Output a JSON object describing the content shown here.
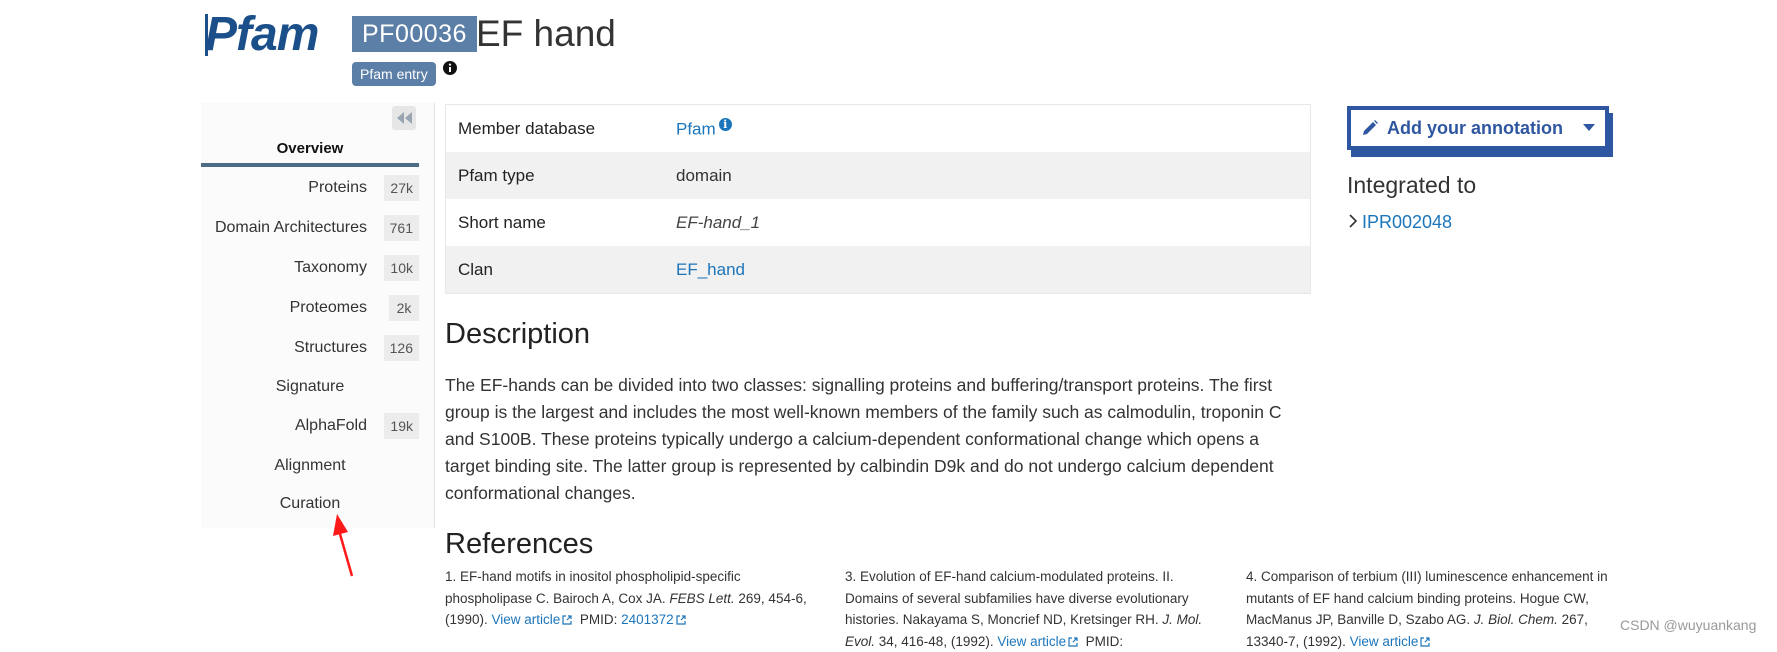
{
  "header": {
    "logo_text": "Pfam",
    "accession": "PF00036",
    "title": "EF hand",
    "entry_tag": "Pfam entry"
  },
  "sidebar": {
    "overview": "Overview",
    "items": [
      {
        "label": "Proteins",
        "count": "27k"
      },
      {
        "label": "Domain Architectures",
        "count": "761"
      },
      {
        "label": "Taxonomy",
        "count": "10k"
      },
      {
        "label": "Proteomes",
        "count": "2k"
      },
      {
        "label": "Structures",
        "count": "126"
      },
      {
        "label": "Signature",
        "count": ""
      },
      {
        "label": "AlphaFold",
        "count": "19k"
      },
      {
        "label": "Alignment",
        "count": ""
      },
      {
        "label": "Curation",
        "count": ""
      }
    ]
  },
  "info_table": {
    "rows": [
      {
        "key": "Member database",
        "value": "Pfam"
      },
      {
        "key": "Pfam type",
        "value": "domain"
      },
      {
        "key": "Short name",
        "value": "EF-hand_1"
      },
      {
        "key": "Clan",
        "value": "EF_hand"
      }
    ]
  },
  "description": {
    "title": "Description",
    "text": "The EF-hands can be divided into two classes: signalling proteins and buffering/transport proteins. The first group is the largest and includes the most well-known members of the family such as calmodulin, troponin C and S100B. These proteins typically undergo a calcium-dependent conformational change which opens a target binding site. The latter group is represented by calbindin D9k and do not undergo calcium dependent conformational changes."
  },
  "references": {
    "title": "References",
    "items": [
      {
        "prefix": "1. EF-hand motifs in inositol phospholipid-specific phospholipase C. Bairoch A, Cox JA. ",
        "journal": "FEBS Lett.",
        "suffix": " 269, 454-6, (1990). ",
        "view_article": "View article",
        "pmid_label": "PMID: ",
        "pmid": "2401372"
      },
      {
        "prefix": "3. Evolution of EF-hand calcium-modulated proteins. II. Domains of several subfamilies have diverse evolutionary histories. Nakayama S, Moncrief ND, Kretsinger RH. ",
        "journal": "J. Mol. Evol.",
        "suffix": " 34, 416-48, (1992). ",
        "view_article": "View article",
        "pmid_label": "PMID:",
        "pmid": ""
      },
      {
        "prefix": "4. Comparison of terbium (III) luminescence enhancement in mutants of EF hand calcium binding proteins. Hogue CW, MacManus JP, Banville D, Szabo AG. ",
        "journal": "J. Biol. Chem.",
        "suffix": " 267, 13340-7, (1992). ",
        "view_article": "View article",
        "pmid_label": "",
        "pmid": ""
      }
    ]
  },
  "right_panel": {
    "annotate_label": "Add your annotation",
    "integrated_title": "Integrated to",
    "integrated_link": "IPR002048"
  },
  "watermark": "CSDN @wuyuankang",
  "colors": {
    "accent": "#5b7fa6",
    "link": "#1b75bb",
    "annotate": "#2f56a0",
    "logo": "#1a4f8a",
    "arrow": "#ff1a1a"
  },
  "icons": [
    "info-icon",
    "double-chevron-left-icon",
    "external-link-icon",
    "pencil-icon",
    "caret-down-icon",
    "chevron-right-icon",
    "red-arrow-annotation"
  ]
}
